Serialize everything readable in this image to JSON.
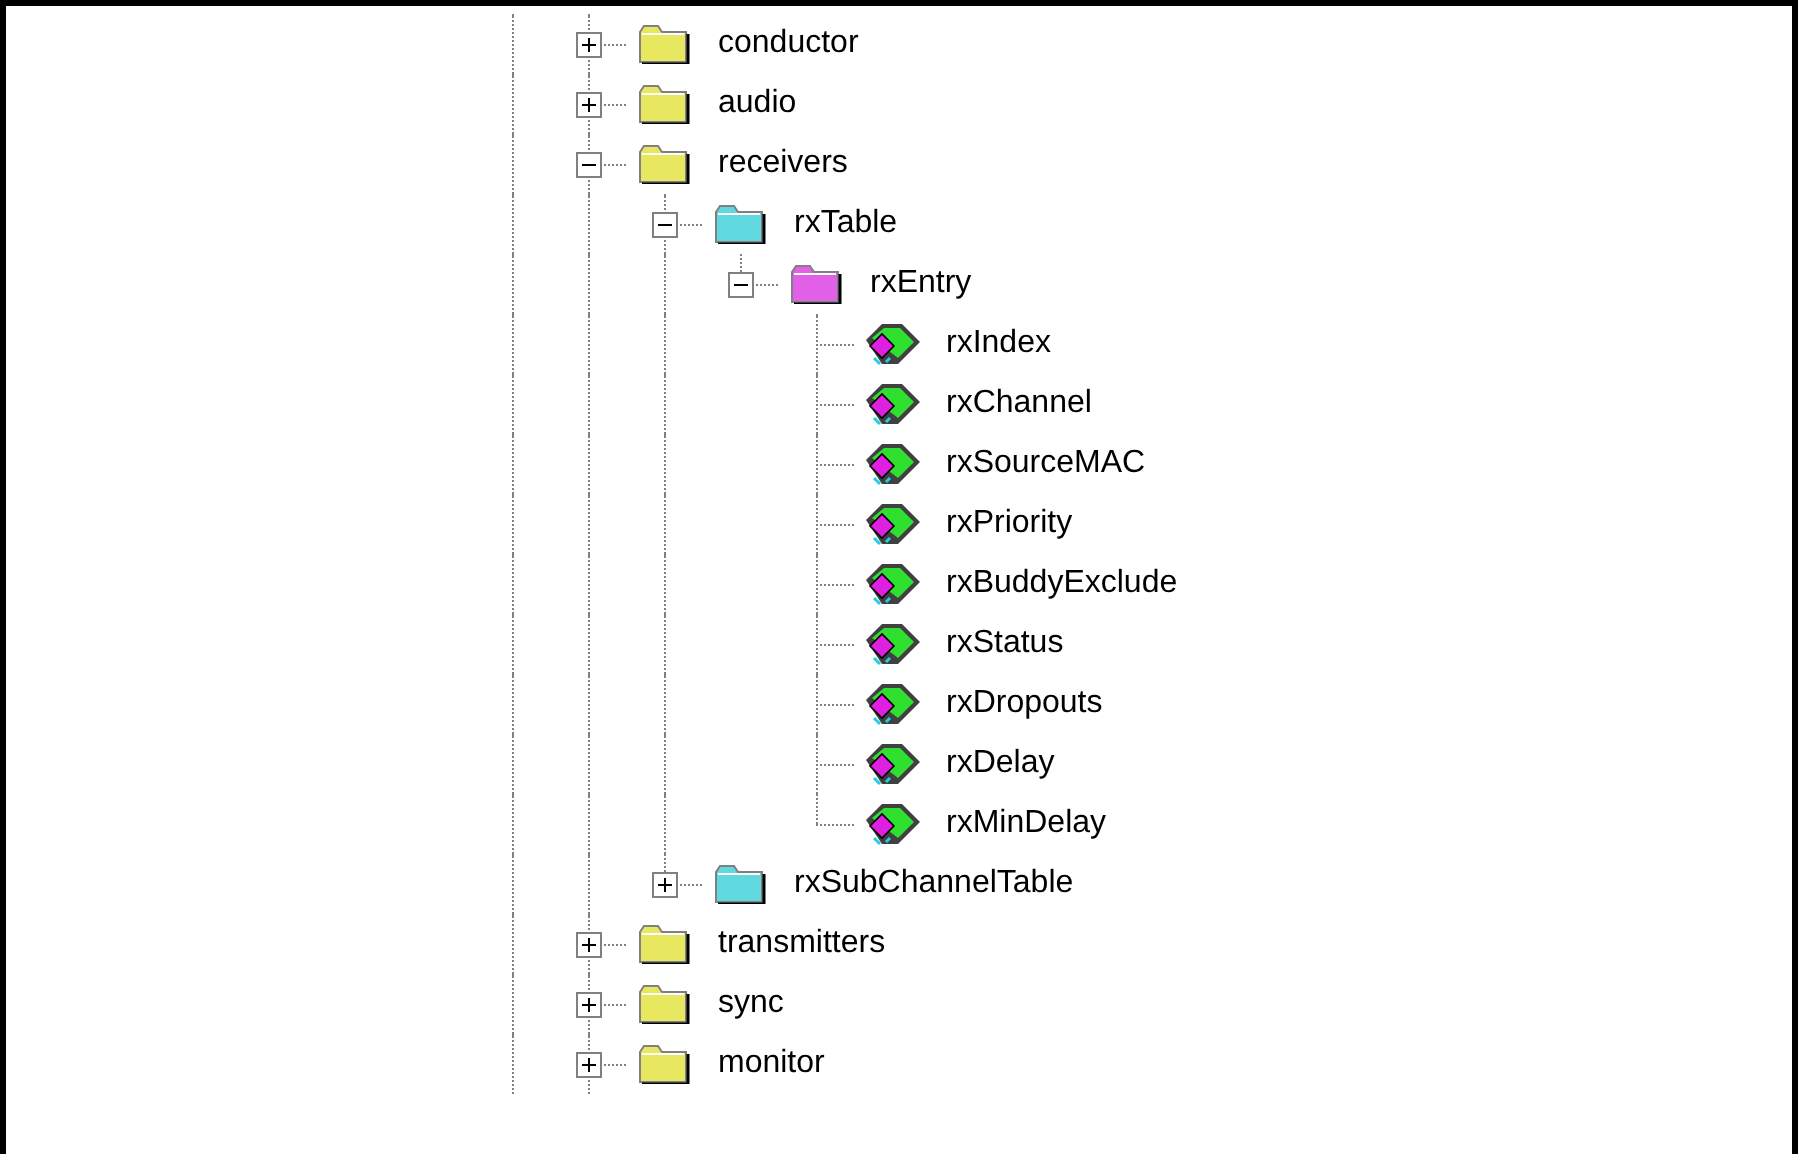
{
  "tree": [
    {
      "label": "conductor",
      "kind": "folder",
      "expanded": false
    },
    {
      "label": "audio",
      "kind": "folder",
      "expanded": false
    },
    {
      "label": "receivers",
      "kind": "folder",
      "expanded": true,
      "children": [
        {
          "label": "rxTable",
          "kind": "table",
          "expanded": true,
          "children": [
            {
              "label": "rxEntry",
              "kind": "entry",
              "expanded": true,
              "children": [
                {
                  "label": "rxIndex",
                  "kind": "leaf"
                },
                {
                  "label": "rxChannel",
                  "kind": "leaf"
                },
                {
                  "label": "rxSourceMAC",
                  "kind": "leaf"
                },
                {
                  "label": "rxPriority",
                  "kind": "leaf"
                },
                {
                  "label": "rxBuddyExclude",
                  "kind": "leaf"
                },
                {
                  "label": "rxStatus",
                  "kind": "leaf"
                },
                {
                  "label": "rxDropouts",
                  "kind": "leaf"
                },
                {
                  "label": "rxDelay",
                  "kind": "leaf"
                },
                {
                  "label": "rxMinDelay",
                  "kind": "leaf"
                }
              ]
            }
          ]
        },
        {
          "label": "rxSubChannelTable",
          "kind": "table",
          "expanded": false
        }
      ]
    },
    {
      "label": "transmitters",
      "kind": "folder",
      "expanded": false
    },
    {
      "label": "sync",
      "kind": "folder",
      "expanded": false
    },
    {
      "label": "monitor",
      "kind": "folder",
      "expanded": false
    }
  ]
}
